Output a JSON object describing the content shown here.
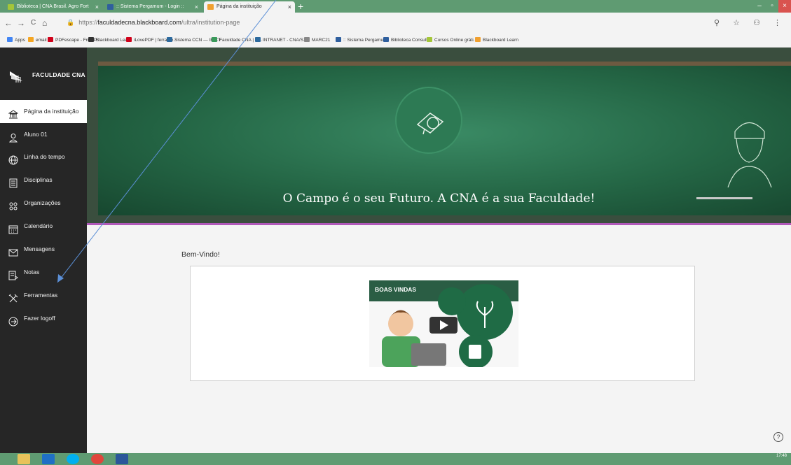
{
  "browser": {
    "tabs": [
      {
        "title": "Biblioteca | CNA Brasil. Agro Fort",
        "active": false,
        "color": "#a4c639"
      },
      {
        "title": ":: Sistema Pergamum - Login ::",
        "active": false,
        "color": "#2f5f9e"
      },
      {
        "title": "Página da instituição",
        "active": true,
        "color": "#f0a030"
      }
    ],
    "new_tab": "+",
    "window_controls": {
      "minimize": "–",
      "maximize": "▫",
      "close": "×"
    },
    "nav": {
      "back": "←",
      "forward": "→",
      "reload": "C",
      "home": "⌂"
    },
    "url_prefix": "https://",
    "url_host": "faculdadecna.blackboard.com",
    "url_path": "/ultra/institution-page",
    "toolbar_right": "⚲ ☆ ⚇ ⋮",
    "bookmarks": [
      {
        "label": "Apps",
        "color": "#4285f4"
      },
      {
        "label": "email",
        "color": "#f5a623"
      },
      {
        "label": "PDFescape - Free P...",
        "color": "#d0021b"
      },
      {
        "label": "Blackboard Learn",
        "color": "#333333"
      },
      {
        "label": "iLovePDF | ferrame...",
        "color": "#d0021b"
      },
      {
        "label": "Sistema CCN — IBICT",
        "color": "#2d6a9e"
      },
      {
        "label": "Faculdade CNA | C...",
        "color": "#3a9a5b"
      },
      {
        "label": "INTRANET - CNA/S...",
        "color": "#2d6a9e"
      },
      {
        "label": "MARC21",
        "color": "#888888"
      },
      {
        "label": ":: Sistema Pergamu...",
        "color": "#2f5f9e"
      },
      {
        "label": "Biblioteca Consulta",
        "color": "#2f5f9e"
      },
      {
        "label": "Cursos Online gráti...",
        "color": "#a4c639"
      },
      {
        "label": "Blackboard Learn",
        "color": "#f0a030"
      }
    ]
  },
  "sidebar": {
    "logo_text": "FACULDADE CNA",
    "items": [
      {
        "label": "Página da instituição",
        "icon": "institution-icon",
        "active": true
      },
      {
        "label": "Aluno 01",
        "icon": "user-icon",
        "active": false
      },
      {
        "label": "Linha do tempo",
        "icon": "globe-icon",
        "active": false
      },
      {
        "label": "Disciplinas",
        "icon": "courses-icon",
        "active": false
      },
      {
        "label": "Organizações",
        "icon": "organizations-icon",
        "active": false
      },
      {
        "label": "Calendário",
        "icon": "calendar-icon",
        "active": false
      },
      {
        "label": "Mensagens",
        "icon": "envelope-icon",
        "active": false
      },
      {
        "label": "Notas",
        "icon": "grades-icon",
        "active": false
      },
      {
        "label": "Ferramentas",
        "icon": "tools-icon",
        "active": false
      },
      {
        "label": "Fazer logoff",
        "icon": "logout-icon",
        "active": false
      }
    ]
  },
  "hero": {
    "title": "O Campo é o seu Futuro. A CNA é a sua Faculdade!"
  },
  "main": {
    "welcome": "Bem-Vindo!",
    "video_title": "BOAS VINDAS"
  },
  "help": "?",
  "taskbar": {
    "time": "17:48",
    "date": "…/…/…"
  }
}
